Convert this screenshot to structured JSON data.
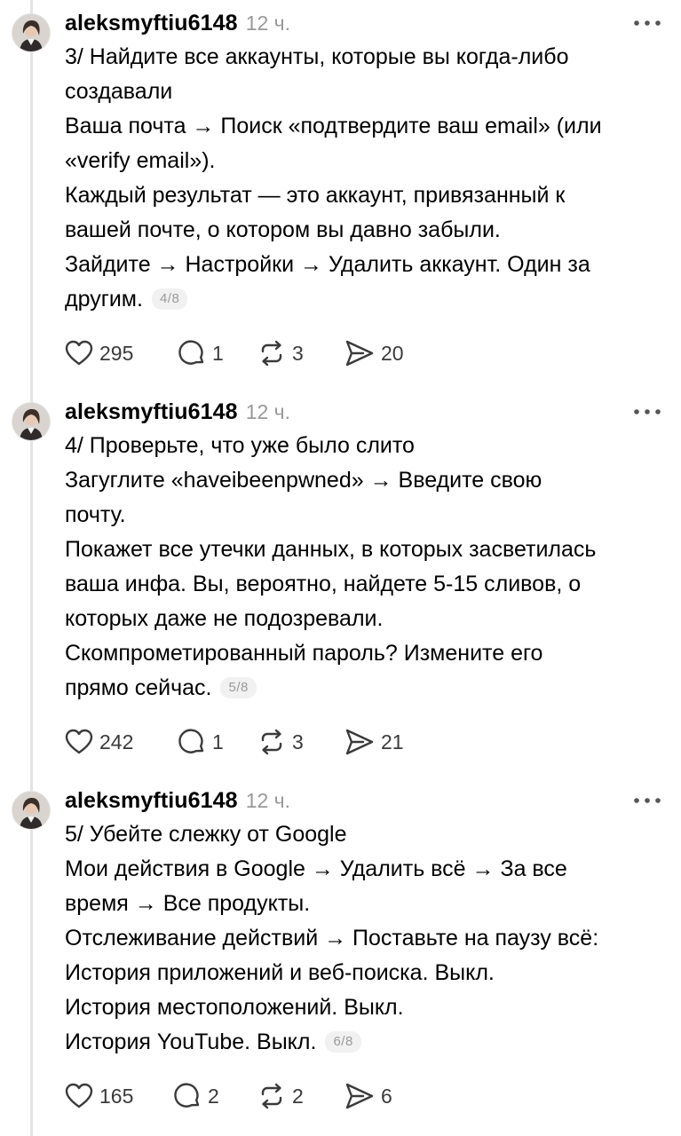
{
  "posts": [
    {
      "username": "aleksmyftiu6148",
      "time": "12 ч.",
      "lines": [
        "3/ Найдите все аккаунты, которые вы когда-либо",
        "создавали",
        "Ваша почта → Поиск «подтвердите ваш email» (или",
        "«verify email»).",
        "Каждый результат — это аккаунт, привязанный к",
        "вашей почте, о котором вы давно забыли.",
        "Зайдите → Настройки → Удалить аккаунт. Один за",
        "другим."
      ],
      "counter": "4/8",
      "likes": "295",
      "replies": "1",
      "reposts": "3",
      "shares": "20"
    },
    {
      "username": "aleksmyftiu6148",
      "time": "12 ч.",
      "lines": [
        "4/ Проверьте, что уже было слито",
        "Загуглите «haveibeenpwned» → Введите свою",
        "почту.",
        "Покажет все утечки данных, в которых засветилась",
        "ваша инфа. Вы, вероятно, найдете 5-15 сливов, о",
        "которых даже не подозревали.",
        "Скомпрометированный пароль? Измените его",
        "прямо сейчас."
      ],
      "counter": "5/8",
      "likes": "242",
      "replies": "1",
      "reposts": "3",
      "shares": "21"
    },
    {
      "username": "aleksmyftiu6148",
      "time": "12 ч.",
      "lines": [
        "5/ Убейте слежку от Google",
        "Мои действия в Google → Удалить всё → За все",
        "время → Все продукты.",
        "Отслеживание действий → Поставьте на паузу всё:",
        "История приложений и веб-поиска. Выкл.",
        "История местоположений. Выкл.",
        "История YouTube. Выкл."
      ],
      "counter": "6/8",
      "likes": "165",
      "replies": "2",
      "reposts": "2",
      "shares": "6"
    }
  ],
  "icons": {
    "like": "heart-icon",
    "reply": "comment-icon",
    "repost": "repost-icon",
    "share": "send-icon",
    "more": "more-dots-icon"
  },
  "colors": {
    "text": "#000000",
    "muted": "#999999",
    "icon": "#3a3a3a",
    "badge_bg": "#f1f1f1",
    "thread_line": "#e4e4e4"
  }
}
